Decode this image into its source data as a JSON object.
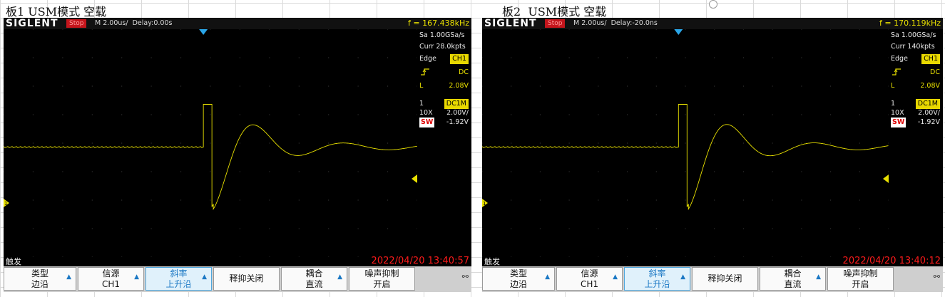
{
  "sheet": {
    "title1": "板1 USM模式 空载",
    "title2": "板2  USM模式 空载"
  },
  "scopes": [
    {
      "logo": "SIGLENT",
      "status": "Stop",
      "timebase": "M 2.00us/  Delay:0.00s",
      "frequency": "f = 167.438kHz",
      "sample_rate": "Sa 1.00GSa/s",
      "curr_points": "Curr 28.0kpts",
      "trigger_type": "Edge",
      "trigger_source": "CH1",
      "slope_icon": "rising-edge-icon",
      "coupling": "DC",
      "level_label": "L",
      "level": "2.08V",
      "ch_num": "1",
      "ch_coupling": "DC1M",
      "probe": "10X",
      "volts_div": "2.00V/",
      "offset": "-1.92V",
      "sw": "SW",
      "trigger_menu_label": "触发",
      "datetime": "2022/04/20 13:40:57",
      "menu": [
        {
          "l1": "类型",
          "l2": "边沿",
          "arrow": true,
          "sel": false
        },
        {
          "l1": "信源",
          "l2": "CH1",
          "arrow": true,
          "sel": false
        },
        {
          "l1": "斜率",
          "l2": "上升沿",
          "arrow": true,
          "sel": true
        },
        {
          "l1": "释抑关闭",
          "l2": "",
          "arrow": false,
          "sel": false
        },
        {
          "l1": "耦合",
          "l2": "直流",
          "arrow": true,
          "sel": false
        },
        {
          "l1": "噪声抑制",
          "l2": "开启",
          "arrow": false,
          "sel": false
        }
      ],
      "waveform": {
        "color": "#e8e000",
        "baseline_div": -0.1,
        "step_start_us": 3.55,
        "freq_khz": 167.438,
        "high_div": 2.2,
        "low_div": -3.0,
        "decay_us": 2.6
      }
    },
    {
      "logo": "SIGLENT",
      "status": "Stop",
      "timebase": "M 2.00us/  Delay:-20.0ns",
      "frequency": "f = 170.119kHz",
      "sample_rate": "Sa 1.00GSa/s",
      "curr_points": "Curr 140kpts",
      "trigger_type": "Edge",
      "trigger_source": "CH1",
      "slope_icon": "rising-edge-icon",
      "coupling": "DC",
      "level_label": "L",
      "level": "2.08V",
      "ch_num": "1",
      "ch_coupling": "DC1M",
      "probe": "10X",
      "volts_div": "2.00V/",
      "offset": "-1.92V",
      "sw": "SW",
      "trigger_menu_label": "触发",
      "datetime": "2022/04/20 13:40:12",
      "menu": [
        {
          "l1": "类型",
          "l2": "边沿",
          "arrow": true,
          "sel": false
        },
        {
          "l1": "信源",
          "l2": "CH1",
          "arrow": true,
          "sel": false
        },
        {
          "l1": "斜率",
          "l2": "上升沿",
          "arrow": true,
          "sel": true
        },
        {
          "l1": "释抑关闭",
          "l2": "",
          "arrow": false,
          "sel": false
        },
        {
          "l1": "耦合",
          "l2": "直流",
          "arrow": true,
          "sel": false
        },
        {
          "l1": "噪声抑制",
          "l2": "开启",
          "arrow": false,
          "sel": false
        }
      ],
      "waveform": {
        "color": "#e8e000",
        "baseline_div": -0.1,
        "step_start_us": 3.55,
        "freq_khz": 170.119,
        "high_div": 2.2,
        "low_div": -3.0,
        "decay_us": 2.6
      }
    }
  ],
  "colors": {
    "trace": "#e8e000",
    "marker_blue": "#2aa6e8",
    "date_red": "#ff1b1b",
    "stop_red": "#c4151c"
  }
}
